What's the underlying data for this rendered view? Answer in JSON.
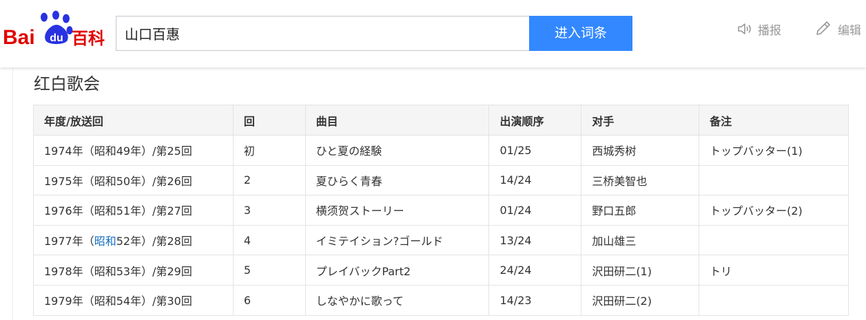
{
  "logo": {
    "text_bai": "Bai",
    "text_du": "du",
    "text_baike": "百科"
  },
  "search": {
    "value": "山口百惠",
    "button_label": "进入词条"
  },
  "toolbar": {
    "play_label": "播报",
    "edit_label": "编辑"
  },
  "section": {
    "title": "红白歌会"
  },
  "table": {
    "headers": [
      "年度/放送回",
      "回",
      "曲目",
      "出演顺序",
      "对手",
      "备注"
    ],
    "rows": [
      {
        "year_prefix": "1974年（",
        "era_link": "",
        "year_suffix": "昭和49年）/第25回",
        "round": "初",
        "song": "ひと夏の経験",
        "order": "01/25",
        "opponent": "西城秀树",
        "note": "トップバッター(1)"
      },
      {
        "year_prefix": "1975年（",
        "era_link": "",
        "year_suffix": "昭和50年）/第26回",
        "round": "2",
        "song": "夏ひらく青春",
        "order": "14/24",
        "opponent": "三桥美智也",
        "note": ""
      },
      {
        "year_prefix": "1976年（",
        "era_link": "",
        "year_suffix": "昭和51年）/第27回",
        "round": "3",
        "song": "横须贺ストーリー",
        "order": "01/24",
        "opponent": "野口五郎",
        "note": "トップバッター(2)"
      },
      {
        "year_prefix": "1977年（",
        "era_link": "昭和",
        "year_suffix": "52年）/第28回",
        "round": "4",
        "song": "イミテイション?ゴールド",
        "order": "13/24",
        "opponent": "加山雄三",
        "note": ""
      },
      {
        "year_prefix": "1978年（",
        "era_link": "",
        "year_suffix": "昭和53年）/第29回",
        "round": "5",
        "song": "プレイバックPart2",
        "order": "24/24",
        "opponent": "沢田研二(1)",
        "note": "トリ"
      },
      {
        "year_prefix": "1979年（",
        "era_link": "",
        "year_suffix": "昭和54年）/第30回",
        "round": "6",
        "song": "しなやかに歌って",
        "order": "14/23",
        "opponent": "沢田研二(2)",
        "note": ""
      }
    ]
  },
  "colors": {
    "accent": "#3388ff",
    "logo_red": "#e10601",
    "logo_blue": "#2932e1",
    "link": "#136ec2"
  }
}
